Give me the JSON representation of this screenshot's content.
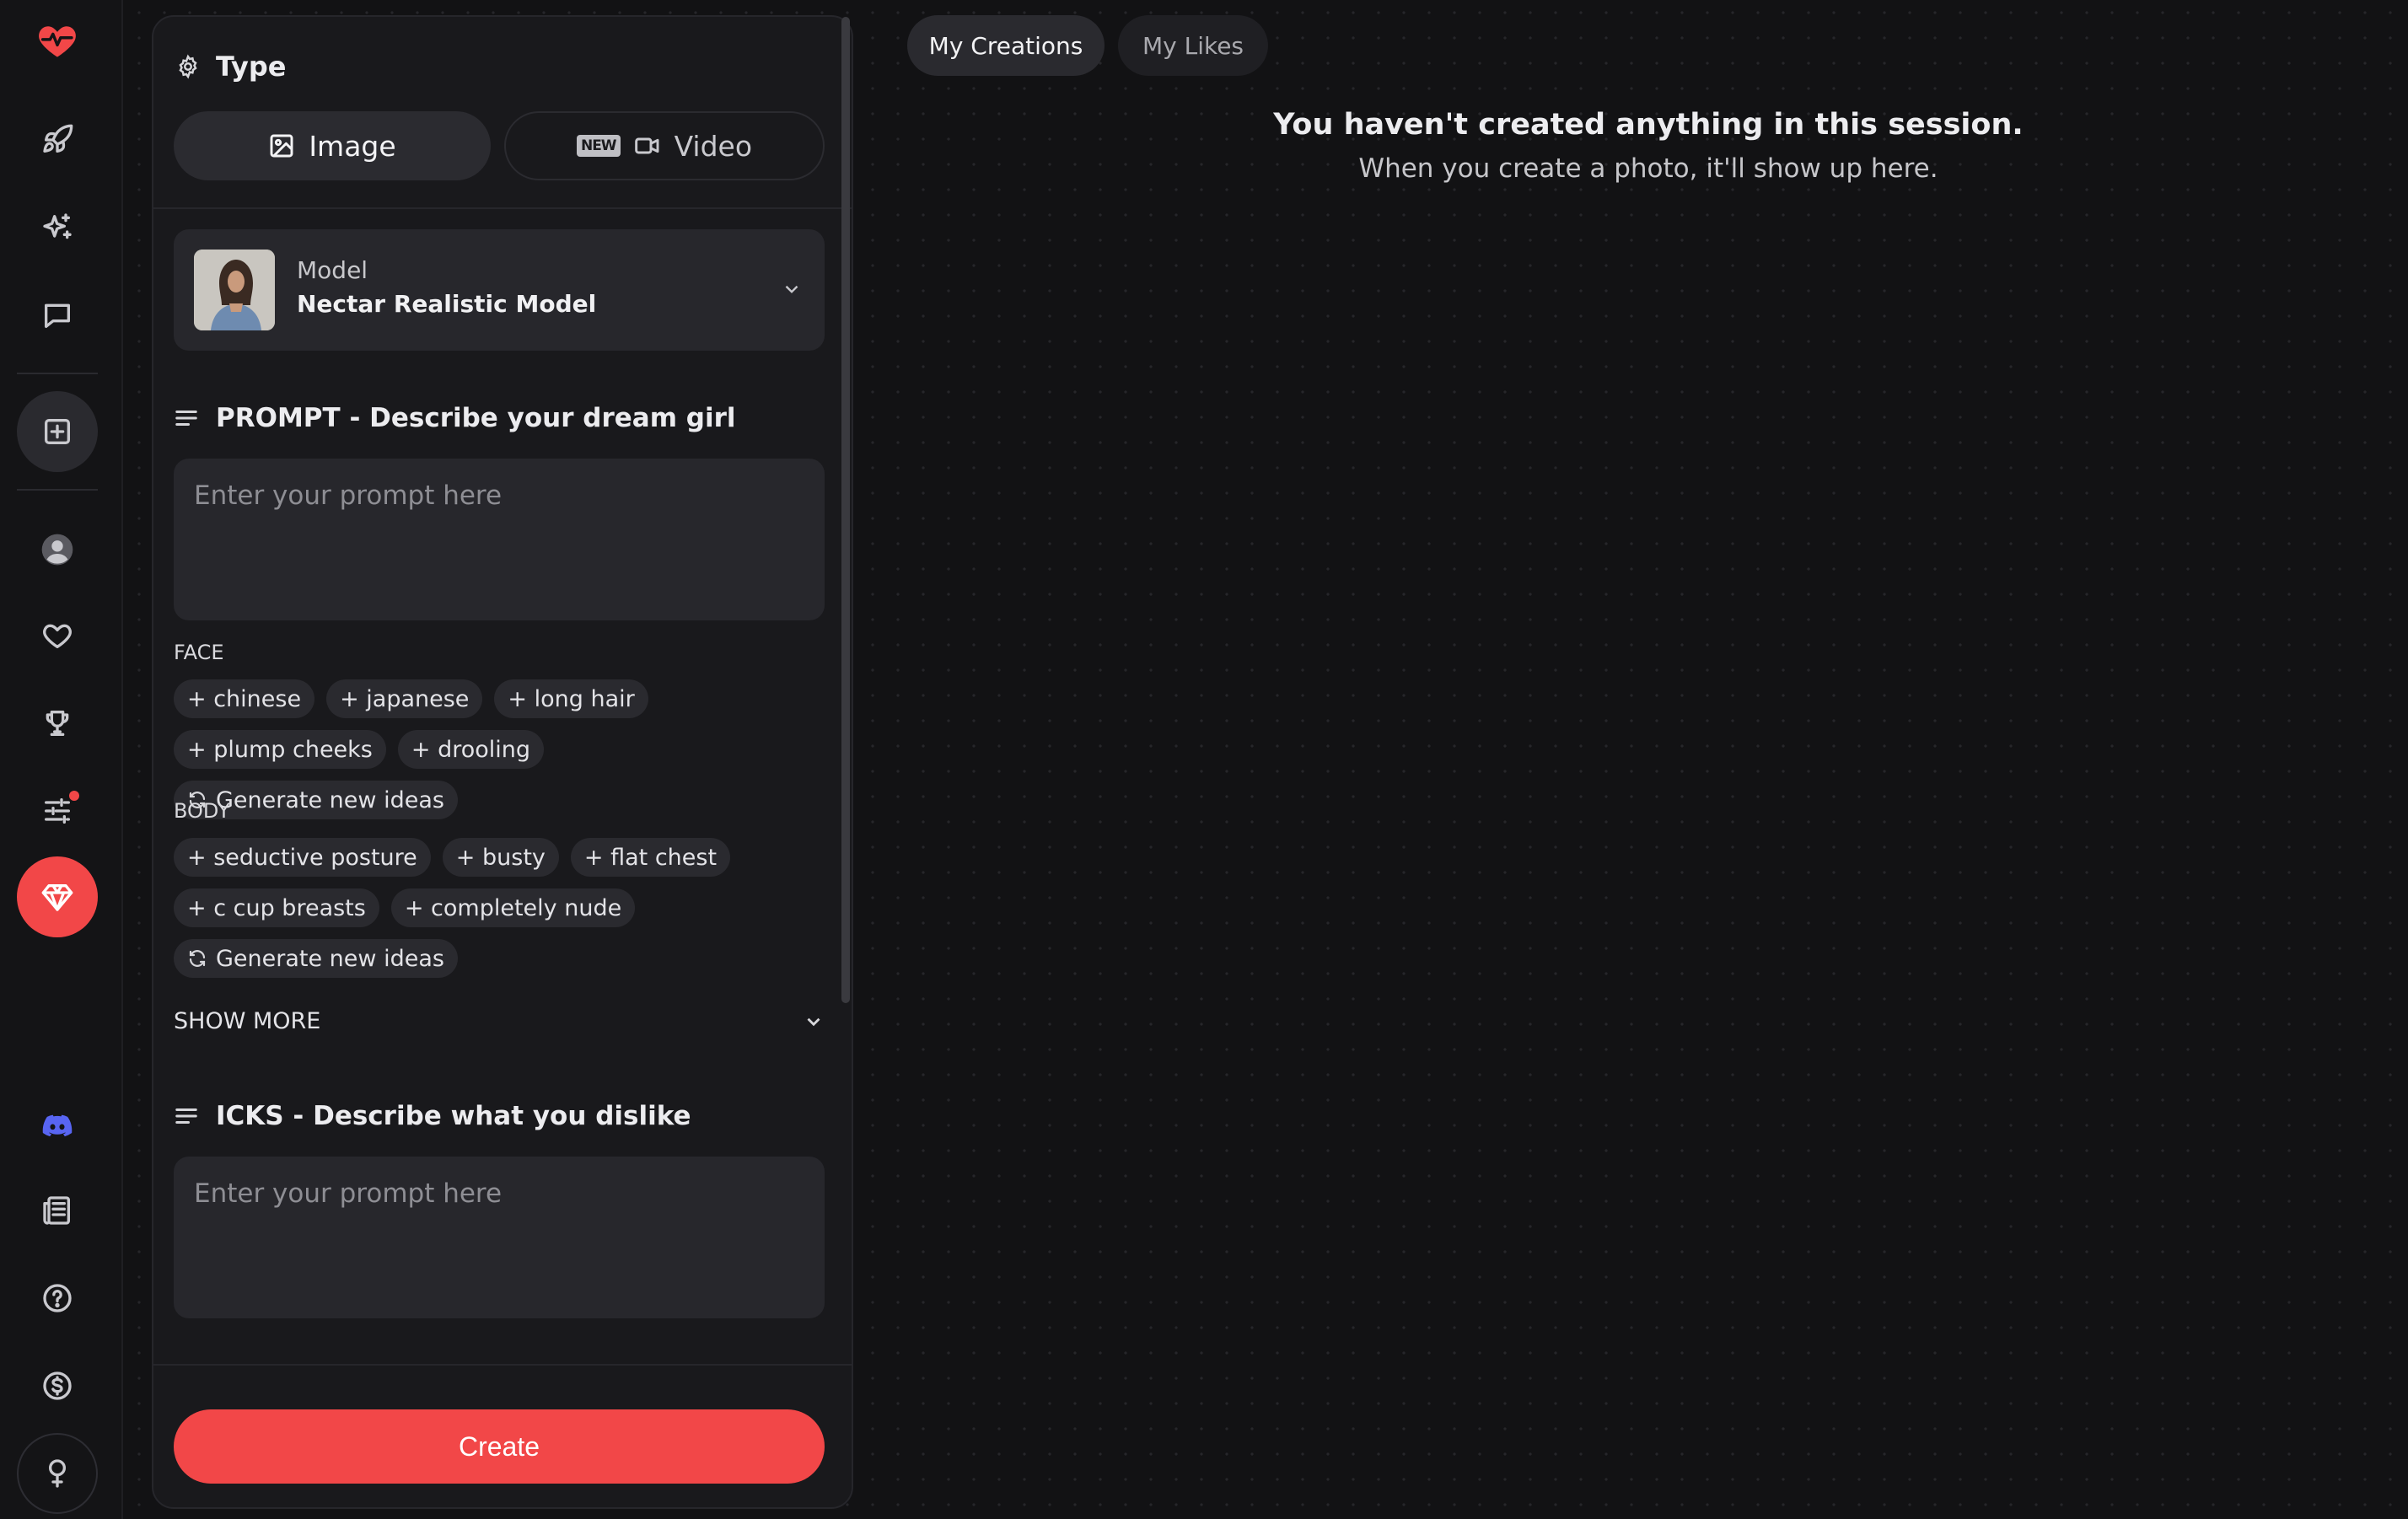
{
  "rail": {
    "items": [
      {
        "name": "logo-heart-icon"
      },
      {
        "name": "rocket-icon"
      },
      {
        "name": "sparkles-icon"
      },
      {
        "name": "chat-icon"
      },
      {
        "name": "create-plus-icon"
      },
      {
        "name": "profile-icon"
      },
      {
        "name": "heart-icon"
      },
      {
        "name": "trophy-icon"
      },
      {
        "name": "sliders-icon"
      },
      {
        "name": "premium-gem-icon"
      },
      {
        "name": "discord-icon"
      },
      {
        "name": "news-icon"
      },
      {
        "name": "help-icon"
      },
      {
        "name": "dollar-icon"
      },
      {
        "name": "lightbulb-icon"
      }
    ]
  },
  "panel": {
    "type_label": "Type",
    "type_tabs": {
      "image": "Image",
      "video": "Video",
      "new_badge": "NEW"
    },
    "model": {
      "label": "Model",
      "value": "Nectar Realistic Model"
    },
    "prompt": {
      "title": "PROMPT - Describe your dream girl",
      "placeholder": "Enter your prompt here"
    },
    "face": {
      "label": "FACE",
      "chips": [
        "+ chinese",
        "+ japanese",
        "+ long hair",
        "+ plump cheeks",
        "+ drooling"
      ],
      "generate": "Generate new ideas"
    },
    "body": {
      "label": "BODY",
      "chips": [
        "+ seductive posture",
        "+ busty",
        "+ flat chest",
        "+ c cup breasts",
        "+ completely nude"
      ],
      "generate": "Generate new ideas"
    },
    "show_more": "SHOW MORE",
    "icks": {
      "title": "ICKS - Describe what you dislike",
      "placeholder": "Enter your prompt here"
    },
    "create_label": "Create"
  },
  "main": {
    "tabs": [
      "My Creations",
      "My Likes"
    ],
    "empty_title": "You haven't created anything in this session.",
    "empty_subtitle": "When you create a photo, it'll show up here."
  },
  "colors": {
    "accent": "#f24748",
    "background": "#121214",
    "panel": "#19191c"
  }
}
